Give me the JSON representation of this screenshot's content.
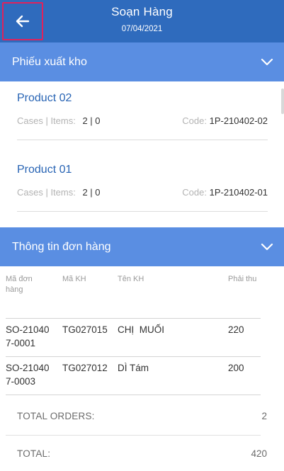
{
  "header": {
    "title": "Soạn Hàng",
    "date": "07/04/2021"
  },
  "sections": {
    "export_slip": "Phiếu xuất kho",
    "order_info": "Thông tin đơn hàng"
  },
  "products": [
    {
      "name": "Product 02",
      "meta_label": "Cases | Items:",
      "qty": "2 | 0",
      "code_label": "Code:",
      "code": "1P-210402-02"
    },
    {
      "name": "Product 01",
      "meta_label": "Cases | Items:",
      "qty": "2 | 0",
      "code_label": "Code:",
      "code": "1P-210402-01"
    }
  ],
  "orders": {
    "columns": {
      "order_no": "Mã đơn hàng",
      "customer_code": "Mã KH",
      "customer_name": "Tên KH",
      "receivable": "Phải thu"
    },
    "rows": [
      {
        "order_no": "SO-210407-0001",
        "customer_code": "TG027015",
        "customer_name": "CHỊ  MUỐI",
        "receivable": "220"
      },
      {
        "order_no": "SO-210407-0003",
        "customer_code": "TG027012",
        "customer_name": "DÌ Tám",
        "receivable": "200"
      }
    ]
  },
  "totals": {
    "orders_label": "TOTAL ORDERS:",
    "orders_value": "2",
    "total_label": "TOTAL:",
    "total_value": "420"
  }
}
